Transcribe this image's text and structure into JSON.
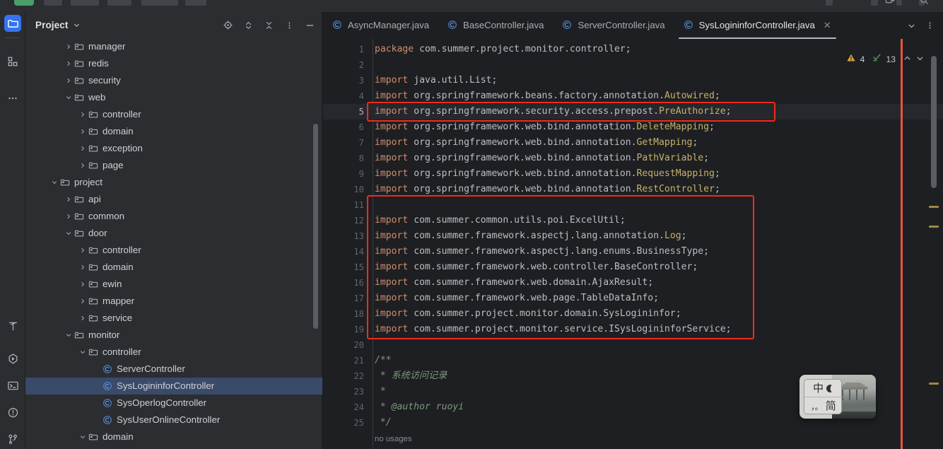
{
  "window": {
    "sidebar_icons": [
      {
        "name": "project-folder-icon",
        "label": "Project",
        "selected": true
      },
      {
        "name": "structure-icon",
        "label": "Structure",
        "selected": false
      },
      {
        "name": "more-tool-windows-icon",
        "label": "More Tool Windows",
        "selected": false
      }
    ],
    "sidebar_icons_bottom": [
      {
        "name": "build-hammer-icon",
        "label": "Build"
      },
      {
        "name": "run-icon",
        "label": "Run"
      },
      {
        "name": "terminal-icon",
        "label": "Terminal"
      },
      {
        "name": "problems-icon",
        "label": "Problems"
      },
      {
        "name": "git-branch-icon",
        "label": "Version Control"
      }
    ]
  },
  "panel": {
    "title": "Project",
    "actions": [
      {
        "name": "locate-file-icon",
        "label": "Select Opened File"
      },
      {
        "name": "expand-collapse-icon",
        "label": "Expand / Collapse"
      },
      {
        "name": "collapse-all-icon",
        "label": "Collapse All"
      },
      {
        "name": "more-options-icon",
        "label": "Options"
      },
      {
        "name": "hide-panel-icon",
        "label": "Hide"
      }
    ],
    "tree": [
      {
        "label": "manager",
        "type": "folder",
        "depth": 2,
        "state": "collapsed"
      },
      {
        "label": "redis",
        "type": "folder",
        "depth": 2,
        "state": "collapsed"
      },
      {
        "label": "security",
        "type": "folder",
        "depth": 2,
        "state": "collapsed"
      },
      {
        "label": "web",
        "type": "folder",
        "depth": 2,
        "state": "expanded"
      },
      {
        "label": "controller",
        "type": "folder",
        "depth": 3,
        "state": "collapsed"
      },
      {
        "label": "domain",
        "type": "folder",
        "depth": 3,
        "state": "collapsed"
      },
      {
        "label": "exception",
        "type": "folder",
        "depth": 3,
        "state": "collapsed"
      },
      {
        "label": "page",
        "type": "folder",
        "depth": 3,
        "state": "collapsed"
      },
      {
        "label": "project",
        "type": "folder",
        "depth": 1,
        "state": "expanded"
      },
      {
        "label": "api",
        "type": "folder",
        "depth": 2,
        "state": "collapsed"
      },
      {
        "label": "common",
        "type": "folder",
        "depth": 2,
        "state": "collapsed"
      },
      {
        "label": "door",
        "type": "folder",
        "depth": 2,
        "state": "expanded"
      },
      {
        "label": "controller",
        "type": "folder",
        "depth": 3,
        "state": "collapsed"
      },
      {
        "label": "domain",
        "type": "folder",
        "depth": 3,
        "state": "collapsed"
      },
      {
        "label": "ewin",
        "type": "folder",
        "depth": 3,
        "state": "collapsed"
      },
      {
        "label": "mapper",
        "type": "folder",
        "depth": 3,
        "state": "collapsed"
      },
      {
        "label": "service",
        "type": "folder",
        "depth": 3,
        "state": "collapsed"
      },
      {
        "label": "monitor",
        "type": "folder",
        "depth": 2,
        "state": "expanded"
      },
      {
        "label": "controller",
        "type": "folder",
        "depth": 3,
        "state": "expanded"
      },
      {
        "label": "ServerController",
        "type": "class",
        "depth": 4,
        "state": "leaf"
      },
      {
        "label": "SysLogininforController",
        "type": "class",
        "depth": 4,
        "state": "leaf",
        "selected": true
      },
      {
        "label": "SysOperlogController",
        "type": "class",
        "depth": 4,
        "state": "leaf"
      },
      {
        "label": "SysUserOnlineController",
        "type": "class",
        "depth": 4,
        "state": "leaf"
      },
      {
        "label": "domain",
        "type": "folder",
        "depth": 3,
        "state": "expanded"
      }
    ]
  },
  "editor": {
    "tabs": [
      {
        "label": "AsyncManager.java",
        "icon": "java-class-icon",
        "active": false
      },
      {
        "label": "BaseController.java",
        "icon": "java-class-icon",
        "active": false
      },
      {
        "label": "ServerController.java",
        "icon": "java-class-icon",
        "active": false
      },
      {
        "label": "SysLogininforController.java",
        "icon": "java-class-icon",
        "active": true
      }
    ],
    "tabbar_actions": [
      {
        "name": "tab-list-chevron-icon",
        "label": "Show Tab List"
      },
      {
        "name": "tab-options-icon",
        "label": "Tab Options"
      }
    ],
    "inspection": {
      "warning_count": "4",
      "ok_count": "13",
      "prev_label": "Previous Highlighted Error",
      "next_label": "Next Highlighted Error",
      "warning_color": "#d9a13b",
      "ok_color": "#4f9e5c"
    },
    "status_text": "no usages",
    "current_line": 5,
    "lines": [
      {
        "n": 1,
        "tokens": [
          {
            "t": "package ",
            "c": "kw"
          },
          {
            "t": "com.summer.project.monitor.controller;",
            "c": "plain"
          }
        ]
      },
      {
        "n": 2,
        "tokens": []
      },
      {
        "n": 3,
        "tokens": [
          {
            "t": "import ",
            "c": "kw"
          },
          {
            "t": "java.util.List;",
            "c": "plain"
          }
        ]
      },
      {
        "n": 4,
        "tokens": [
          {
            "t": "import ",
            "c": "kw"
          },
          {
            "t": "org.springframework.beans.factory.annotation.",
            "c": "plain"
          },
          {
            "t": "Autowired",
            "c": "cls"
          },
          {
            "t": ";",
            "c": "plain"
          }
        ]
      },
      {
        "n": 5,
        "tokens": [
          {
            "t": "import ",
            "c": "kw"
          },
          {
            "t": "org.springframework.security.access.prepost.",
            "c": "plain"
          },
          {
            "t": "PreAuthorize",
            "c": "cls"
          },
          {
            "t": ";",
            "c": "plain"
          }
        ]
      },
      {
        "n": 6,
        "tokens": [
          {
            "t": "import ",
            "c": "kw"
          },
          {
            "t": "org.springframework.web.bind.annotation.",
            "c": "plain"
          },
          {
            "t": "DeleteMapping",
            "c": "cls"
          },
          {
            "t": ";",
            "c": "plain"
          }
        ]
      },
      {
        "n": 7,
        "tokens": [
          {
            "t": "import ",
            "c": "kw"
          },
          {
            "t": "org.springframework.web.bind.annotation.",
            "c": "plain"
          },
          {
            "t": "GetMapping",
            "c": "cls"
          },
          {
            "t": ";",
            "c": "plain"
          }
        ]
      },
      {
        "n": 8,
        "tokens": [
          {
            "t": "import ",
            "c": "kw"
          },
          {
            "t": "org.springframework.web.bind.annotation.",
            "c": "plain"
          },
          {
            "t": "PathVariable",
            "c": "cls"
          },
          {
            "t": ";",
            "c": "plain"
          }
        ]
      },
      {
        "n": 9,
        "tokens": [
          {
            "t": "import ",
            "c": "kw"
          },
          {
            "t": "org.springframework.web.bind.annotation.",
            "c": "plain"
          },
          {
            "t": "RequestMapping",
            "c": "cls"
          },
          {
            "t": ";",
            "c": "plain"
          }
        ]
      },
      {
        "n": 10,
        "tokens": [
          {
            "t": "import ",
            "c": "kw"
          },
          {
            "t": "org.springframework.web.bind.annotation.",
            "c": "plain"
          },
          {
            "t": "RestController",
            "c": "cls"
          },
          {
            "t": ";",
            "c": "plain"
          }
        ]
      },
      {
        "n": 11,
        "tokens": []
      },
      {
        "n": 12,
        "tokens": [
          {
            "t": "import ",
            "c": "kw"
          },
          {
            "t": "com.summer.common.utils.poi.ExcelUtil;",
            "c": "plain"
          }
        ]
      },
      {
        "n": 13,
        "tokens": [
          {
            "t": "import ",
            "c": "kw"
          },
          {
            "t": "com.summer.framework.aspectj.lang.annotation.",
            "c": "plain"
          },
          {
            "t": "Log",
            "c": "cls"
          },
          {
            "t": ";",
            "c": "plain"
          }
        ]
      },
      {
        "n": 14,
        "tokens": [
          {
            "t": "import ",
            "c": "kw"
          },
          {
            "t": "com.summer.framework.aspectj.lang.enums.BusinessType;",
            "c": "plain"
          }
        ]
      },
      {
        "n": 15,
        "tokens": [
          {
            "t": "import ",
            "c": "kw"
          },
          {
            "t": "com.summer.framework.web.controller.BaseController;",
            "c": "plain"
          }
        ]
      },
      {
        "n": 16,
        "tokens": [
          {
            "t": "import ",
            "c": "kw"
          },
          {
            "t": "com.summer.framework.web.domain.AjaxResult;",
            "c": "plain"
          }
        ]
      },
      {
        "n": 17,
        "tokens": [
          {
            "t": "import ",
            "c": "kw"
          },
          {
            "t": "com.summer.framework.web.page.TableDataInfo;",
            "c": "plain"
          }
        ]
      },
      {
        "n": 18,
        "tokens": [
          {
            "t": "import ",
            "c": "kw"
          },
          {
            "t": "com.summer.project.monitor.domain.SysLogininfor;",
            "c": "plain"
          }
        ]
      },
      {
        "n": 19,
        "tokens": [
          {
            "t": "import ",
            "c": "kw"
          },
          {
            "t": "com.summer.project.monitor.service.ISysLogininforService;",
            "c": "plain"
          }
        ]
      },
      {
        "n": 20,
        "tokens": []
      },
      {
        "n": 21,
        "tokens": [
          {
            "t": "/**",
            "c": "cmt"
          }
        ]
      },
      {
        "n": 22,
        "tokens": [
          {
            "t": " * 系统访问记录",
            "c": "cmt"
          }
        ]
      },
      {
        "n": 23,
        "tokens": [
          {
            "t": " *",
            "c": "cmt"
          }
        ]
      },
      {
        "n": 24,
        "tokens": [
          {
            "t": " * @author ruoyi",
            "c": "cmt"
          }
        ]
      },
      {
        "n": 25,
        "tokens": [
          {
            "t": " */",
            "c": "cmt"
          }
        ]
      }
    ],
    "highlights": [
      {
        "name": "red-annotation-box-import-preauthorize",
        "line_from": 5,
        "line_to": 5
      },
      {
        "name": "red-annotation-box-project-imports",
        "line_from": 11,
        "line_to": 19
      }
    ],
    "markers": [
      {
        "name": "warning-marker",
        "color": "#a1873d"
      },
      {
        "name": "warning-marker",
        "color": "#a1873d"
      },
      {
        "name": "warning-marker",
        "color": "#a1873d"
      }
    ]
  },
  "ime": {
    "mode_cjk": "中",
    "mode_label": "简",
    "punct": "，。",
    "moon_icon": "dark-mode-moon-icon"
  }
}
